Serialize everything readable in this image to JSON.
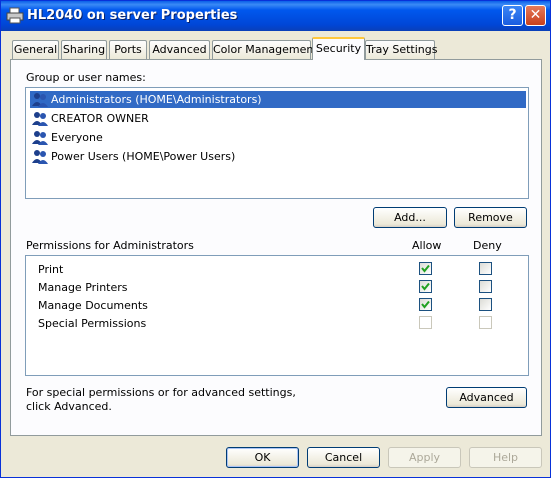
{
  "window": {
    "title": "HL2040 on server Properties",
    "help_label": "?",
    "close_label": "✕"
  },
  "tabs": [
    "General",
    "Sharing",
    "Ports",
    "Advanced",
    "Color Management",
    "Security",
    "Tray Settings"
  ],
  "security": {
    "group_label": "Group or user names:",
    "users": [
      "Administrators (HOME\\Administrators)",
      "CREATOR OWNER",
      "Everyone",
      "Power Users (HOME\\Power Users)"
    ],
    "add_label": "Add...",
    "remove_label": "Remove",
    "permissions_label": "Permissions for Administrators",
    "allow_label": "Allow",
    "deny_label": "Deny",
    "permissions": [
      {
        "name": "Print",
        "allow": true,
        "deny": false,
        "enabled": true
      },
      {
        "name": "Manage Printers",
        "allow": true,
        "deny": false,
        "enabled": true
      },
      {
        "name": "Manage Documents",
        "allow": true,
        "deny": false,
        "enabled": true
      },
      {
        "name": "Special Permissions",
        "allow": false,
        "deny": false,
        "enabled": false
      }
    ],
    "special_note_line1": "For special permissions or for advanced settings,",
    "special_note_line2": "click Advanced.",
    "advanced_label": "Advanced"
  },
  "footer": {
    "ok_label": "OK",
    "cancel_label": "Cancel",
    "apply_label": "Apply",
    "help_label": "Help"
  }
}
